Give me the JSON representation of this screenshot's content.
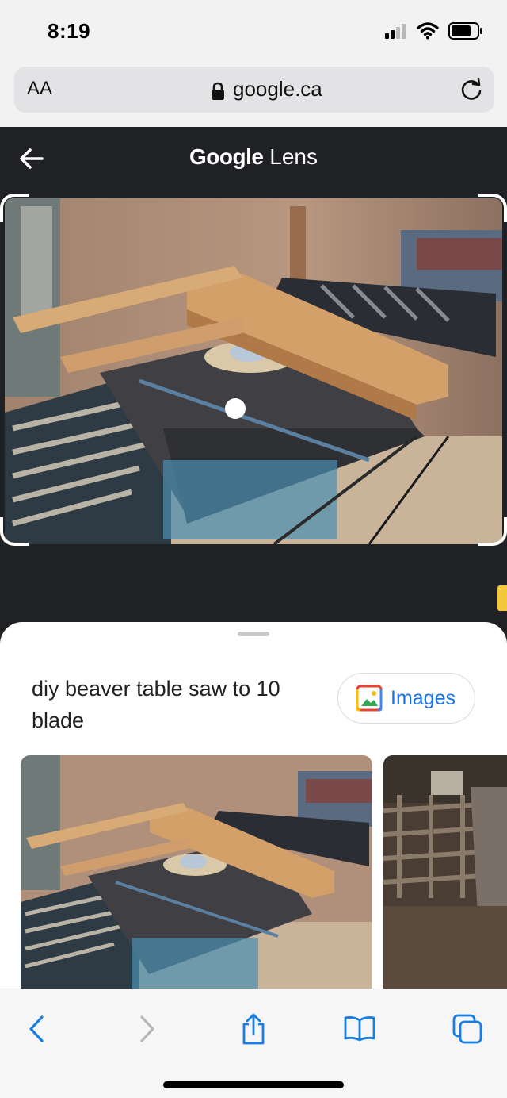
{
  "status_bar": {
    "time": "8:19"
  },
  "browser": {
    "text_size_label": "AA",
    "domain": "google.ca"
  },
  "lens": {
    "title_brand": "Google",
    "title_product": "Lens"
  },
  "results": {
    "query": "diy beaver table saw to 10 blade",
    "images_button_label": "Images"
  },
  "colors": {
    "accent": "#1a73e8",
    "dark_bg": "#202124",
    "toolbar_blue": "#1a7ee0"
  },
  "toolbar": {
    "items": [
      "back-icon",
      "forward-icon",
      "share-icon",
      "bookmarks-icon",
      "tabs-icon"
    ]
  }
}
